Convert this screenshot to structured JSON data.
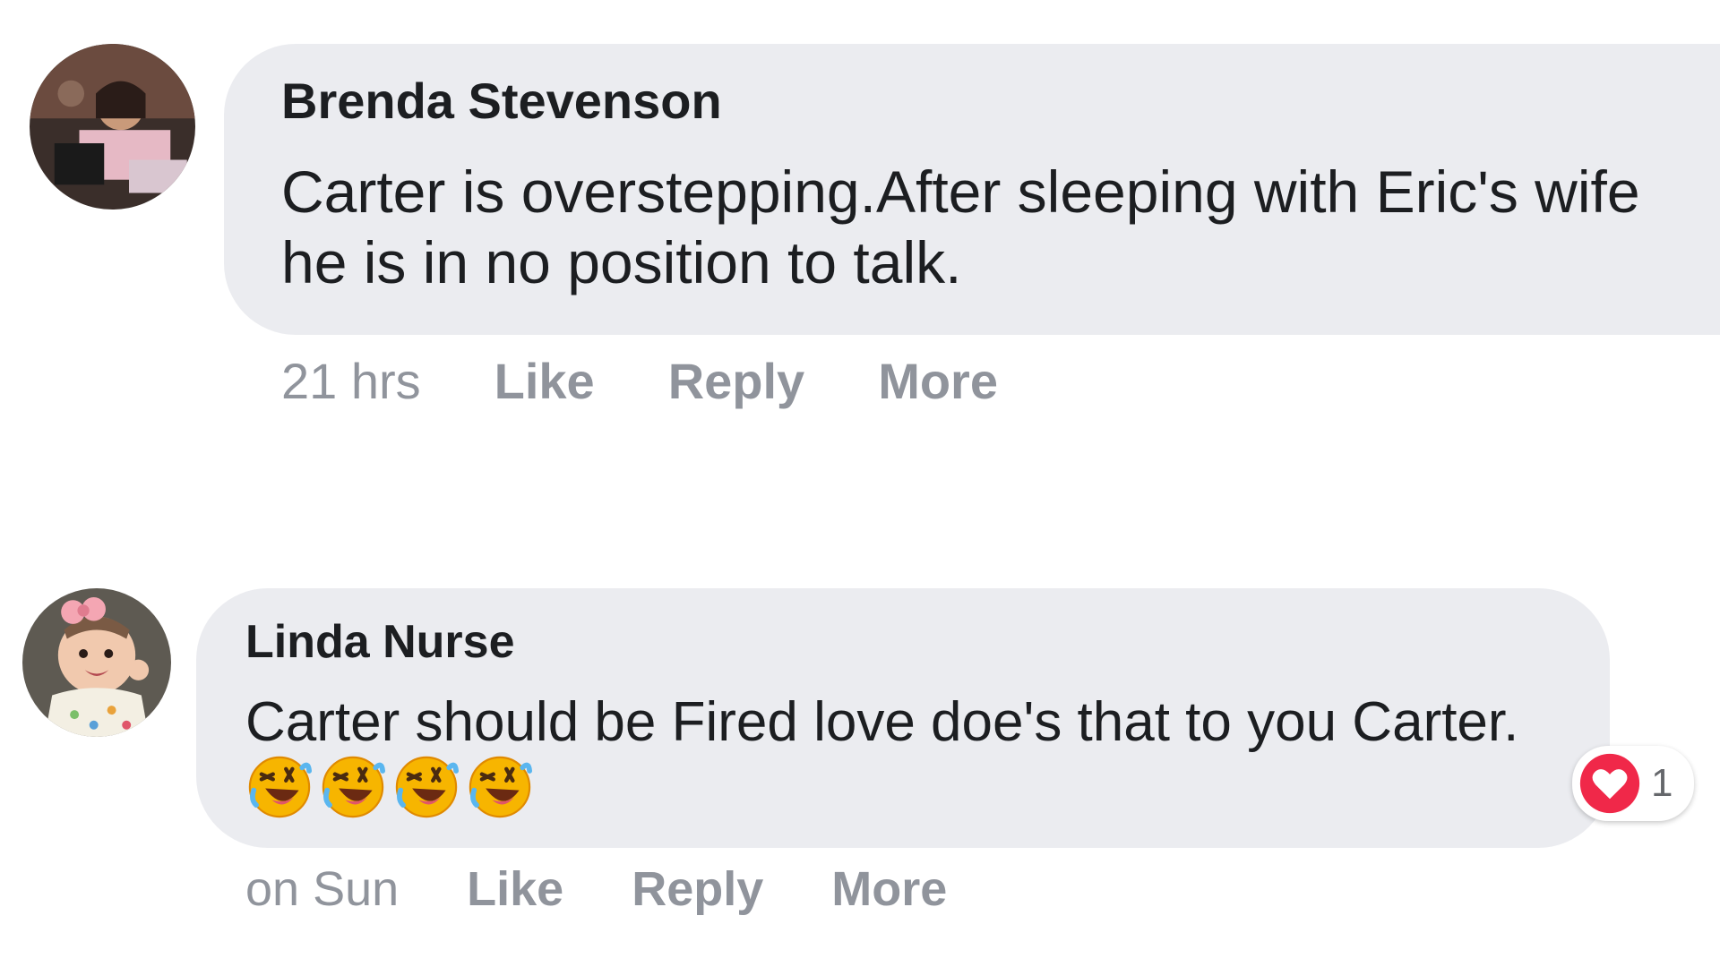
{
  "comments": [
    {
      "author": "Brenda Stevenson",
      "text": "Carter is overstepping.After sleeping with Eric's wife he is in no position to talk.",
      "time": "21 hrs",
      "actions": {
        "like": "Like",
        "reply": "Reply",
        "more": "More"
      }
    },
    {
      "author": "Linda Nurse",
      "text": "Carter should be Fired love doe's that to you Carter.",
      "emojis": [
        "rolling-on-floor-laughing",
        "rolling-on-floor-laughing",
        "rolling-on-floor-laughing",
        "rolling-on-floor-laughing"
      ],
      "time": "on Sun",
      "actions": {
        "like": "Like",
        "reply": "Reply",
        "more": "More"
      },
      "reaction": {
        "icon": "heart-reaction-icon",
        "count": "1",
        "color": "#f02849"
      }
    }
  ],
  "colors": {
    "bubble": "#ebecf0",
    "text": "#1c1e21",
    "meta": "#90949c",
    "background": "#ffffff"
  }
}
